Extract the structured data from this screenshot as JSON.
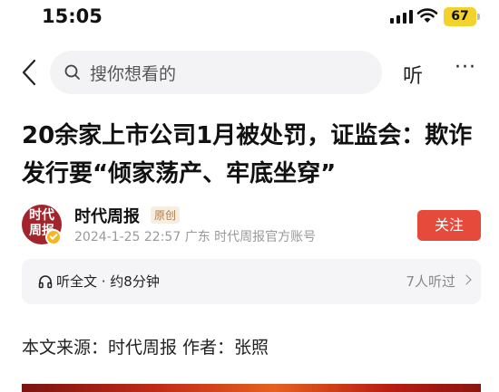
{
  "status_bar": {
    "time": "15:05",
    "battery": "67",
    "battery_color": "#f3d22d"
  },
  "search": {
    "placeholder": "搜你想看的",
    "icon": "search-icon"
  },
  "header": {
    "listen_label": "听",
    "more_label": "···"
  },
  "article": {
    "title": "20余家上市公司1月被处罚，证监会：欺诈发行要“倾家荡产、牢底坐穿”",
    "author": {
      "name": "时代周报",
      "avatar_text_line1": "时代",
      "avatar_text_line2": "周报",
      "tag": "原创",
      "meta": "2024-1-25  22:57  广东  时代周报官方账号",
      "follow_label": "关注",
      "follow_color": "#e64a3b"
    },
    "listen": {
      "label": "听全文 · 约8分钟",
      "count": "7人听过"
    },
    "source": "本文来源：时代周报 作者：张照"
  }
}
